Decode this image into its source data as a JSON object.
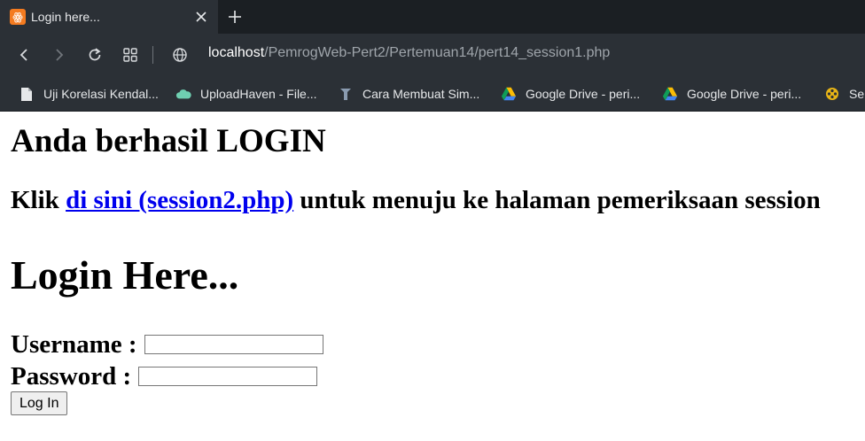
{
  "browser": {
    "tab": {
      "favicon_text": "ꙮ",
      "title": "Login here..."
    },
    "url": {
      "host": "localhost",
      "path": "/PemrogWeb-Pert2/Pertemuan14/pert14_session1.php"
    },
    "bookmarks": [
      {
        "label": "Uji Korelasi Kendal...",
        "icon": "document-icon"
      },
      {
        "label": "UploadHaven - File...",
        "icon": "cloud-icon"
      },
      {
        "label": "Cara Membuat Sim...",
        "icon": "blog-icon"
      },
      {
        "label": "Google Drive - peri...",
        "icon": "google-drive-icon"
      },
      {
        "label": "Google Drive - peri...",
        "icon": "google-drive-icon"
      },
      {
        "label": "Se",
        "icon": "film-icon"
      }
    ]
  },
  "page": {
    "success_heading": "Anda berhasil LOGIN",
    "link_prefix": "Klik ",
    "link_text": "di sini (session2.php)",
    "link_suffix": " untuk menuju ke halaman pemeriksaan session",
    "login_title": "Login Here...",
    "username_label": "Username : ",
    "username_value": "",
    "password_label": "Password : ",
    "password_value": "",
    "login_button": "Log In"
  }
}
